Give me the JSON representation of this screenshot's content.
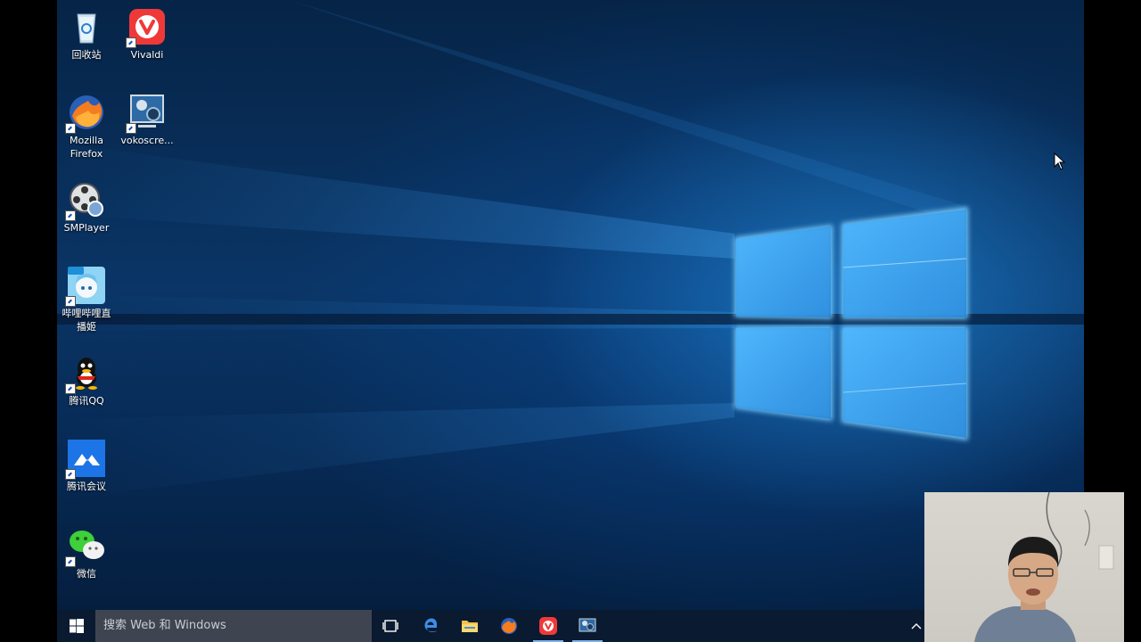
{
  "desktop": {
    "icons": [
      {
        "label": "回收站",
        "icon": "recycle-bin-icon"
      },
      {
        "label": "Vivaldi",
        "icon": "vivaldi-icon"
      },
      {
        "label": "Mozilla Firefox",
        "icon": "firefox-icon"
      },
      {
        "label": "vokoscre...",
        "icon": "vokoscreen-icon"
      },
      {
        "label": "SMPlayer",
        "icon": "smplayer-icon"
      },
      {
        "label": "哔哩哔哩直播姬",
        "icon": "bilibili-live-icon"
      },
      {
        "label": "腾讯QQ",
        "icon": "qq-icon"
      },
      {
        "label": "腾讯会议",
        "icon": "tencent-meeting-icon"
      },
      {
        "label": "微信",
        "icon": "wechat-icon"
      }
    ]
  },
  "taskbar": {
    "search_placeholder": "搜索 Web 和 Windows",
    "pinned": [
      "task-view-icon",
      "edge-icon",
      "file-explorer-icon",
      "firefox-icon",
      "vivaldi-icon",
      "vokoscreen-icon"
    ]
  },
  "colors": {
    "accent": "#1e90ff",
    "vivaldi": "#ef3939",
    "taskbar": "#0a1a30"
  }
}
